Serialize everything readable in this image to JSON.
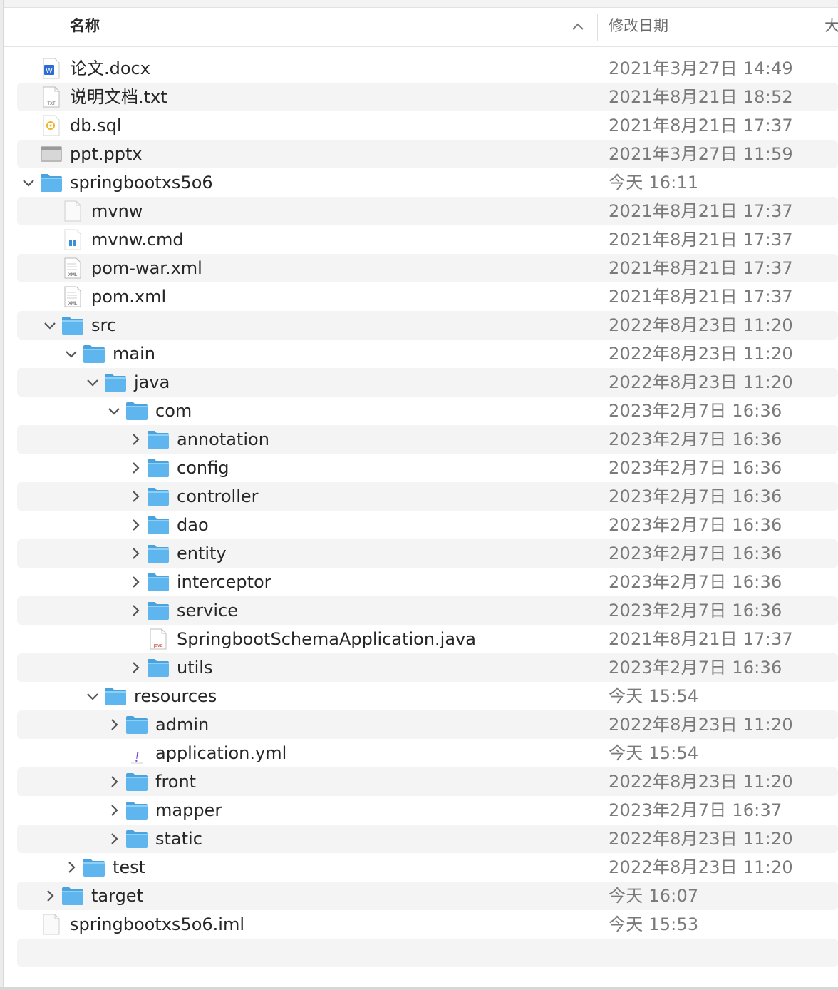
{
  "columns": {
    "name": "名称",
    "modified": "修改日期",
    "size": "大"
  },
  "rows": [
    {
      "name": "论文.docx",
      "date": "2021年3月27日 14:49",
      "depth": 0,
      "icon": "docx-icon",
      "disclosure": "none"
    },
    {
      "name": "说明文档.txt",
      "date": "2021年8月21日 18:52",
      "depth": 0,
      "icon": "txt-icon",
      "disclosure": "none"
    },
    {
      "name": "db.sql",
      "date": "2021年8月21日 17:37",
      "depth": 0,
      "icon": "sql-icon",
      "disclosure": "none"
    },
    {
      "name": "ppt.pptx",
      "date": "2021年3月27日 11:59",
      "depth": 0,
      "icon": "pptx-icon",
      "disclosure": "none"
    },
    {
      "name": "springbootxs5o6",
      "date": "今天 16:11",
      "depth": 0,
      "icon": "folder-icon",
      "disclosure": "open"
    },
    {
      "name": "mvnw",
      "date": "2021年8月21日 17:37",
      "depth": 1,
      "icon": "blank-file-icon",
      "disclosure": "none"
    },
    {
      "name": "mvnw.cmd",
      "date": "2021年8月21日 17:37",
      "depth": 1,
      "icon": "cmd-file-icon",
      "disclosure": "none"
    },
    {
      "name": "pom-war.xml",
      "date": "2021年8月21日 17:37",
      "depth": 1,
      "icon": "xml-file-icon",
      "disclosure": "none"
    },
    {
      "name": "pom.xml",
      "date": "2021年8月21日 17:37",
      "depth": 1,
      "icon": "xml-file-icon",
      "disclosure": "none"
    },
    {
      "name": "src",
      "date": "2022年8月23日 11:20",
      "depth": 1,
      "icon": "folder-icon",
      "disclosure": "open"
    },
    {
      "name": "main",
      "date": "2022年8月23日 11:20",
      "depth": 2,
      "icon": "folder-icon",
      "disclosure": "open"
    },
    {
      "name": "java",
      "date": "2022年8月23日 11:20",
      "depth": 3,
      "icon": "folder-icon",
      "disclosure": "open"
    },
    {
      "name": "com",
      "date": "2023年2月7日 16:36",
      "depth": 4,
      "icon": "folder-icon",
      "disclosure": "open"
    },
    {
      "name": "annotation",
      "date": "2023年2月7日 16:36",
      "depth": 5,
      "icon": "folder-icon",
      "disclosure": "closed"
    },
    {
      "name": "config",
      "date": "2023年2月7日 16:36",
      "depth": 5,
      "icon": "folder-icon",
      "disclosure": "closed"
    },
    {
      "name": "controller",
      "date": "2023年2月7日 16:36",
      "depth": 5,
      "icon": "folder-icon",
      "disclosure": "closed"
    },
    {
      "name": "dao",
      "date": "2023年2月7日 16:36",
      "depth": 5,
      "icon": "folder-icon",
      "disclosure": "closed"
    },
    {
      "name": "entity",
      "date": "2023年2月7日 16:36",
      "depth": 5,
      "icon": "folder-icon",
      "disclosure": "closed"
    },
    {
      "name": "interceptor",
      "date": "2023年2月7日 16:36",
      "depth": 5,
      "icon": "folder-icon",
      "disclosure": "closed"
    },
    {
      "name": "service",
      "date": "2023年2月7日 16:36",
      "depth": 5,
      "icon": "folder-icon",
      "disclosure": "closed"
    },
    {
      "name": "SpringbootSchemaApplication.java",
      "date": "2021年8月21日 17:37",
      "depth": 5,
      "icon": "java-file-icon",
      "disclosure": "none"
    },
    {
      "name": "utils",
      "date": "2023年2月7日 16:36",
      "depth": 5,
      "icon": "folder-icon",
      "disclosure": "closed"
    },
    {
      "name": "resources",
      "date": "今天 15:54",
      "depth": 3,
      "icon": "folder-icon",
      "disclosure": "open"
    },
    {
      "name": "admin",
      "date": "2022年8月23日 11:20",
      "depth": 4,
      "icon": "folder-icon",
      "disclosure": "closed"
    },
    {
      "name": "application.yml",
      "date": "今天 15:54",
      "depth": 4,
      "icon": "yml-file-icon",
      "disclosure": "none"
    },
    {
      "name": "front",
      "date": "2022年8月23日 11:20",
      "depth": 4,
      "icon": "folder-icon",
      "disclosure": "closed"
    },
    {
      "name": "mapper",
      "date": "2023年2月7日 16:37",
      "depth": 4,
      "icon": "folder-icon",
      "disclosure": "closed"
    },
    {
      "name": "static",
      "date": "2022年8月23日 11:20",
      "depth": 4,
      "icon": "folder-icon",
      "disclosure": "closed"
    },
    {
      "name": "test",
      "date": "2022年8月23日 11:20",
      "depth": 2,
      "icon": "folder-icon",
      "disclosure": "closed"
    },
    {
      "name": "target",
      "date": "今天 16:07",
      "depth": 1,
      "icon": "folder-icon",
      "disclosure": "closed"
    },
    {
      "name": "springbootxs5o6.iml",
      "date": "今天 15:53",
      "depth": 0,
      "icon": "blank-file-icon",
      "disclosure": "none"
    },
    {
      "name": "",
      "date": "",
      "depth": 0,
      "icon": "",
      "disclosure": "none"
    }
  ],
  "colors": {
    "folder": "#5fb6ee",
    "folderTab": "#4aa3dc",
    "rowAlt": "#f4f4f5",
    "dateText": "#7a7a7a",
    "wordBlue": "#2d6bd6",
    "javaRed": "#c0392b",
    "ymlPurple": "#7b4fc9"
  }
}
